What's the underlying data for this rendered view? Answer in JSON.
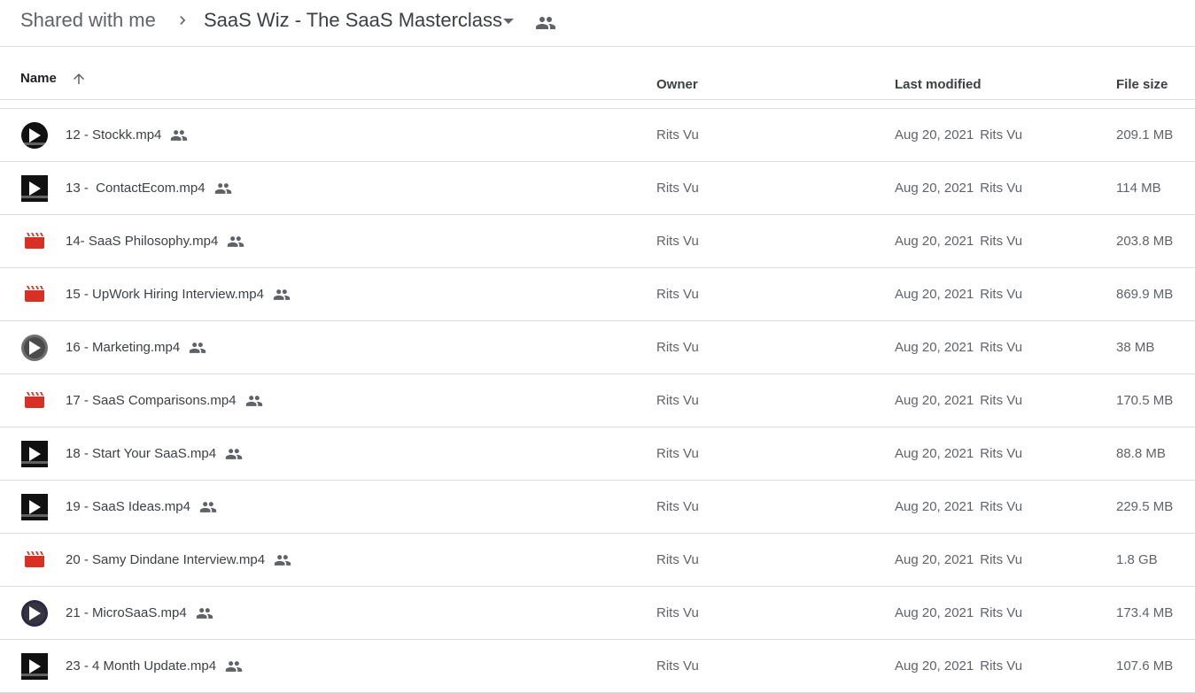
{
  "breadcrumb": {
    "root": "Shared with me",
    "current": "SaaS Wiz - The SaaS Masterclass",
    "separator_icon": "chevron-right-icon",
    "dropdown_icon": "arrow-drop-down-icon",
    "shared_icon": "people-icon"
  },
  "columns": {
    "name": "Name",
    "owner": "Owner",
    "last_modified": "Last modified",
    "file_size": "File size",
    "sort_icon": "arrow-up-icon"
  },
  "colors": {
    "clapper": "#d93025",
    "divider": "#dadce0",
    "text_primary": "#3c4043",
    "text_secondary": "#5f6368"
  },
  "files": [
    {
      "name": "12 - Stockk.mp4",
      "thumb": "video-thumbnail",
      "owner": "Rits Vu",
      "modified_date": "Aug 20, 2021",
      "modified_by": "Rits Vu",
      "size": "209.1 MB"
    },
    {
      "name": "13 -  ContactEcom.mp4",
      "thumb": "video-thumbnail",
      "owner": "Rits Vu",
      "modified_date": "Aug 20, 2021",
      "modified_by": "Rits Vu",
      "size": "114 MB"
    },
    {
      "name": "14- SaaS Philosophy.mp4",
      "thumb": "video-file-icon",
      "owner": "Rits Vu",
      "modified_date": "Aug 20, 2021",
      "modified_by": "Rits Vu",
      "size": "203.8 MB"
    },
    {
      "name": "15 - UpWork Hiring Interview.mp4",
      "thumb": "video-file-icon",
      "owner": "Rits Vu",
      "modified_date": "Aug 20, 2021",
      "modified_by": "Rits Vu",
      "size": "869.9 MB"
    },
    {
      "name": "16 - Marketing.mp4",
      "thumb": "video-thumbnail",
      "owner": "Rits Vu",
      "modified_date": "Aug 20, 2021",
      "modified_by": "Rits Vu",
      "size": "38 MB"
    },
    {
      "name": "17 - SaaS Comparisons.mp4",
      "thumb": "video-file-icon",
      "owner": "Rits Vu",
      "modified_date": "Aug 20, 2021",
      "modified_by": "Rits Vu",
      "size": "170.5 MB"
    },
    {
      "name": "18 - Start Your SaaS.mp4",
      "thumb": "video-thumbnail",
      "owner": "Rits Vu",
      "modified_date": "Aug 20, 2021",
      "modified_by": "Rits Vu",
      "size": "88.8 MB"
    },
    {
      "name": "19 - SaaS Ideas.mp4",
      "thumb": "video-thumbnail",
      "owner": "Rits Vu",
      "modified_date": "Aug 20, 2021",
      "modified_by": "Rits Vu",
      "size": "229.5 MB"
    },
    {
      "name": "20 - Samy Dindane Interview.mp4",
      "thumb": "video-file-icon",
      "owner": "Rits Vu",
      "modified_date": "Aug 20, 2021",
      "modified_by": "Rits Vu",
      "size": "1.8 GB"
    },
    {
      "name": "21 - MicroSaaS.mp4",
      "thumb": "video-thumbnail",
      "owner": "Rits Vu",
      "modified_date": "Aug 20, 2021",
      "modified_by": "Rits Vu",
      "size": "173.4 MB"
    },
    {
      "name": "23 - 4 Month Update.mp4",
      "thumb": "video-thumbnail",
      "owner": "Rits Vu",
      "modified_date": "Aug 20, 2021",
      "modified_by": "Rits Vu",
      "size": "107.6 MB"
    }
  ]
}
